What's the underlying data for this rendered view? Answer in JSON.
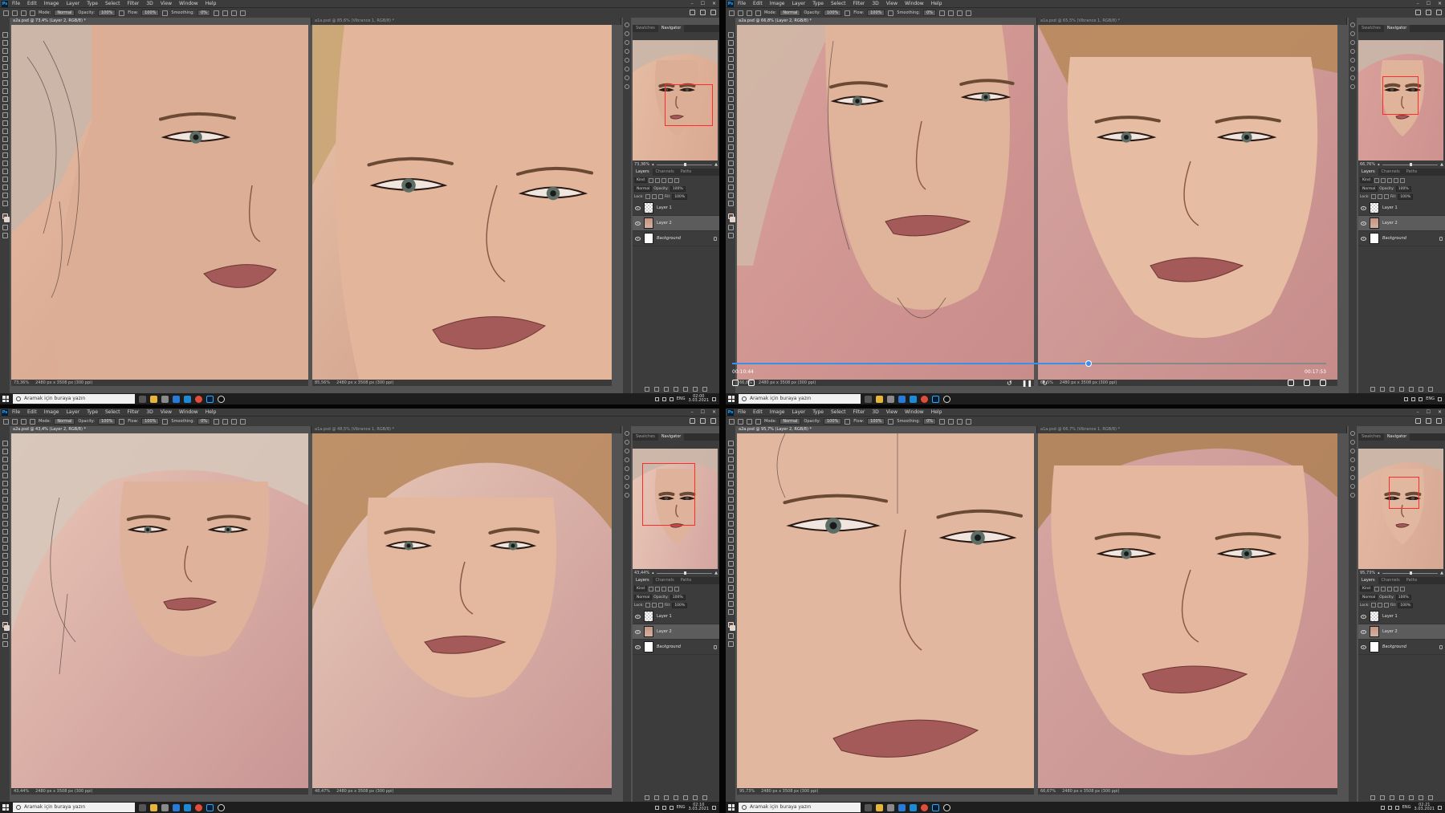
{
  "menu": [
    "File",
    "Edit",
    "Image",
    "Layer",
    "Type",
    "Select",
    "Filter",
    "3D",
    "View",
    "Window",
    "Help"
  ],
  "options": {
    "mode_label": "Mode:",
    "mode_value": "Normal",
    "opacity_label": "Opacity:",
    "opacity_value": "100%",
    "flow_label": "Flow:",
    "flow_value": "100%",
    "smoothing_label": "Smoothing:",
    "smoothing_value": "0%"
  },
  "panels": {
    "top_tabs": [
      "Swatches",
      "Navigator"
    ],
    "layer_tabs": [
      "Layers",
      "Channels",
      "Paths"
    ],
    "kind_label": "Kind",
    "blend_mode": "Normal",
    "opacity_label": "Opacity:",
    "opacity_value": "100%",
    "lock_label": "Lock:",
    "fill_label": "Fill:",
    "fill_value": "100%",
    "layers": [
      "Layer 1",
      "Layer 2",
      "Background"
    ]
  },
  "taskbar": {
    "search_placeholder": "Aramak için buraya yazın",
    "lang": "ENG"
  },
  "quadrants": [
    {
      "tab_left": "a2a.psd @ 73,4% (Layer 2, RGB/8) *",
      "tab_right": "a1a.psd @ 85,6% (Vibrance 1, RGB/8) *",
      "zoom_left": "73,36%",
      "zoom_right": "85,56%",
      "doc_size": "2480 px x 3508 px (300 ppi)",
      "nav_zoom": "73,36%",
      "clock_time": "02:00",
      "clock_date": "3.03.2021"
    },
    {
      "tab_left": "a2a.psd @ 66,8% (Layer 2, RGB/8) *",
      "tab_right": "a1a.psd @ 65,5% (Vibrance 1, RGB/8) *",
      "zoom_left": "66,8%",
      "zoom_right": "65,5%",
      "doc_size": "2480 px x 3508 px (300 ppi)",
      "nav_zoom": "66,76%",
      "video_elapsed": "00:10:44",
      "video_total": "00:17:53",
      "video_progress": 0.6
    },
    {
      "tab_left": "a2a.psd @ 43,4% (Layer 2, RGB/8) *",
      "tab_right": "a1a.psd @ 48,5% (Vibrance 1, RGB/8) *",
      "zoom_left": "43,44%",
      "zoom_right": "48,47%",
      "doc_size": "2480 px x 3508 px (300 ppi)",
      "nav_zoom": "43,44%",
      "clock_time": "02:10",
      "clock_date": "3.03.2021"
    },
    {
      "tab_left": "a2a.psd @ 95,7% (Layer 2, RGB/8) *",
      "tab_right": "a1a.psd @ 66,7% (Vibrance 1, RGB/8) *",
      "zoom_left": "95,73%",
      "zoom_right": "66,67%",
      "doc_size": "2480 px x 3508 px (300 ppi)",
      "nav_zoom": "95,73%",
      "clock_time": "02:21",
      "clock_date": "3.03.2021"
    }
  ],
  "colors": {
    "skin": "#d9a88f",
    "bg_pink": "#c88c8a",
    "panel": "#3c3c3c",
    "accent": "#31a8ff",
    "nav_box": "#ff2b2b"
  }
}
